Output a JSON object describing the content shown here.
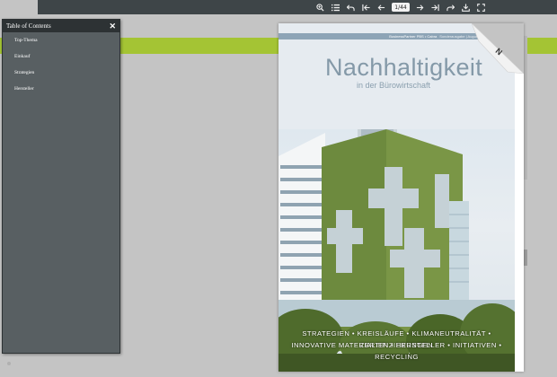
{
  "toolbar": {
    "buttons": [
      {
        "name": "zoom-icon",
        "glyph": "⊕"
      },
      {
        "name": "list-icon",
        "glyph": "≡"
      },
      {
        "name": "undo-icon",
        "glyph": "↶"
      },
      {
        "name": "first-page-icon",
        "glyph": "⇤"
      },
      {
        "name": "prev-page-icon",
        "glyph": "←"
      }
    ],
    "page_counter": "1/44",
    "buttons_after": [
      {
        "name": "next-page-icon",
        "glyph": "→"
      },
      {
        "name": "last-page-icon",
        "glyph": "⇥"
      },
      {
        "name": "redo-icon",
        "glyph": "↷"
      },
      {
        "name": "download-icon",
        "glyph": "⤓"
      },
      {
        "name": "fullscreen-icon",
        "glyph": "⛶"
      }
    ]
  },
  "toc": {
    "title": "Table of Contents",
    "close_glyph": "✕",
    "items": [
      "Top-Thema",
      "Einkauf",
      "Strategien",
      "Hersteller"
    ]
  },
  "cover": {
    "strip": "BusinessPartner PBS • Cabra",
    "strip_extra": "Sonderausgabe | August 2023",
    "title": "Nachhaltigkeit",
    "subtitle": "in der Bürowirtschaft",
    "topics_line1": "STRATEGIEN • KREISLÄUFE • KLIMANEUTRALITÄT • ZERTIFIZIERUNGEN",
    "topics_line2": "INNOVATIVE MATERIALIEN • HERSTELLER • INITIATIVEN • RECYCLING",
    "corner_label": "N"
  },
  "colors": {
    "toolbar": "#3e4548",
    "green_band": "#a4c434",
    "toc_bg": "#585f62",
    "background": "#c4c4c4"
  }
}
